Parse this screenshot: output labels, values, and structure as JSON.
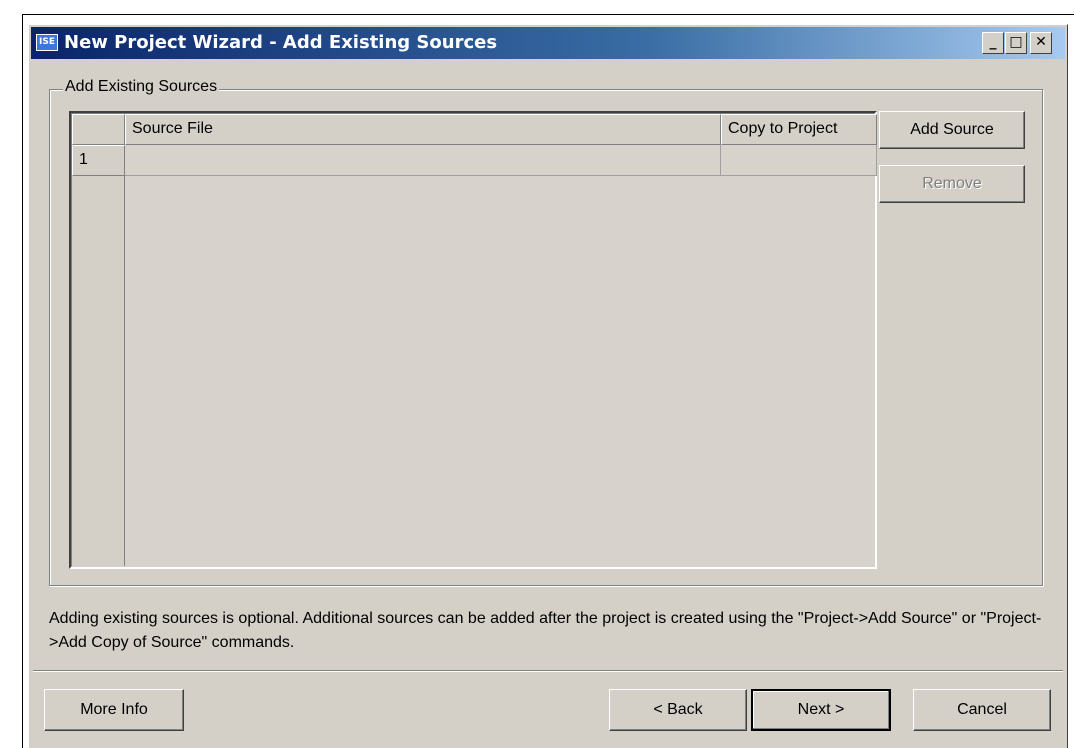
{
  "window": {
    "title": "New Project Wizard - Add Existing Sources",
    "icon_text": "ISE",
    "controls": {
      "minimize": "_",
      "maximize": "□",
      "close": "✕"
    }
  },
  "groupbox": {
    "label": "Add Existing Sources"
  },
  "grid": {
    "columns": [
      "Source File",
      "Copy to Project"
    ],
    "rows": [
      {
        "index": "1",
        "source_file": "",
        "copy_to_project": ""
      }
    ]
  },
  "side_buttons": {
    "add_source": "Add Source",
    "remove": "Remove"
  },
  "info_text": "Adding existing sources is optional. Additional sources can be added after the project is created using the \"Project->Add Source\" or \"Project->Add Copy of Source\" commands.",
  "footer": {
    "more_info": "More Info",
    "back": "< Back",
    "next": "Next >",
    "cancel": "Cancel"
  }
}
